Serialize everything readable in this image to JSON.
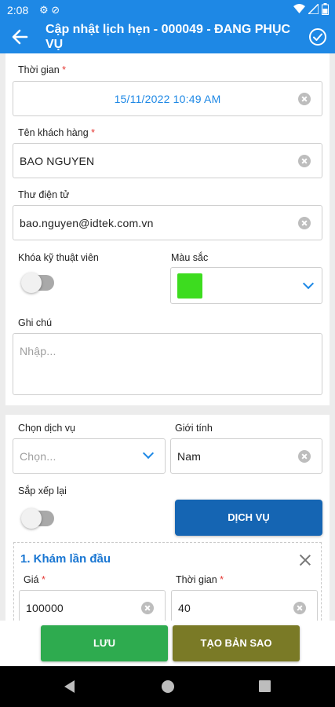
{
  "status_bar": {
    "time": "2:08"
  },
  "app_bar": {
    "title": "Cập nhật lịch hẹn - 000049 - ĐANG PHỤC VỤ"
  },
  "form": {
    "time": {
      "label": "Thời gian",
      "value": "15/11/2022 10:49 AM"
    },
    "customer_name": {
      "label": "Tên khách hàng",
      "value": "BAO NGUYEN"
    },
    "email": {
      "label": "Thư điện tử",
      "value": "bao.nguyen@idtek.com.vn"
    },
    "lock_technician": {
      "label": "Khóa kỹ thuật viên",
      "enabled": false
    },
    "color": {
      "label": "Màu sắc",
      "value": "#3ddc1f"
    },
    "note": {
      "label": "Ghi chú",
      "placeholder": "Nhập..."
    }
  },
  "services_section": {
    "choose_service": {
      "label": "Chọn dịch vụ",
      "placeholder": "Chọn..."
    },
    "gender": {
      "label": "Giới tính",
      "value": "Nam"
    },
    "reorder": {
      "label": "Sắp xếp lại",
      "enabled": false
    },
    "services_button": "DỊCH VỤ",
    "items": [
      {
        "title": "1. Khám lần đầu",
        "price_label": "Giá",
        "price": "100000",
        "duration_label": "Thời gian",
        "duration": "40"
      }
    ]
  },
  "actions": {
    "save": "LƯU",
    "copy": "TẠO BẢN SAO"
  },
  "colors": {
    "primary": "#1e88e5",
    "save": "#2eab4f",
    "copy": "#7a7a26",
    "service_button": "#1565b3"
  },
  "icons": [
    "back-arrow-icon",
    "check-circle-icon",
    "settings-icon",
    "sync-icon",
    "wifi-icon",
    "signal-icon",
    "battery-icon",
    "clear-icon",
    "chevron-down-icon",
    "close-icon"
  ]
}
